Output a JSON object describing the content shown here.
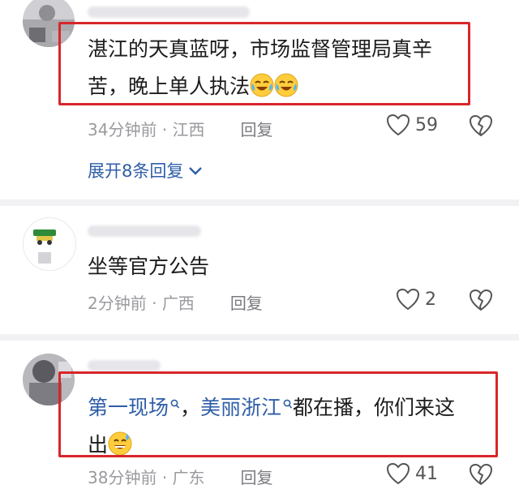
{
  "comments": [
    {
      "text_line1": "湛江的天真蓝呀，市场监督管理局真辛",
      "text_line2": "苦，晚上单人执法",
      "emoji": [
        "crying-laughing-emoji",
        "crying-laughing-emoji"
      ],
      "time": "34分钟前",
      "location": "江西",
      "reply_label": "回复",
      "likes": "59",
      "expand_label": "展开8条回复"
    },
    {
      "text": "坐等官方公告",
      "time": "2分钟前",
      "location": "广西",
      "reply_label": "回复",
      "likes": "2"
    },
    {
      "link1": "第一现场",
      "sep": "，",
      "link2": "美丽浙江",
      "text_rest": "都在播，你们来这",
      "text_line2": "出",
      "emoji": [
        "sweat-smile-emoji"
      ],
      "time": "38分钟前",
      "location": "广东",
      "reply_label": "回复",
      "likes": "41"
    }
  ],
  "meta_separator": " · ",
  "colors": {
    "highlight_box": "#d8262a",
    "link": "#2f5ea8",
    "meta": "#9a9a9f"
  }
}
